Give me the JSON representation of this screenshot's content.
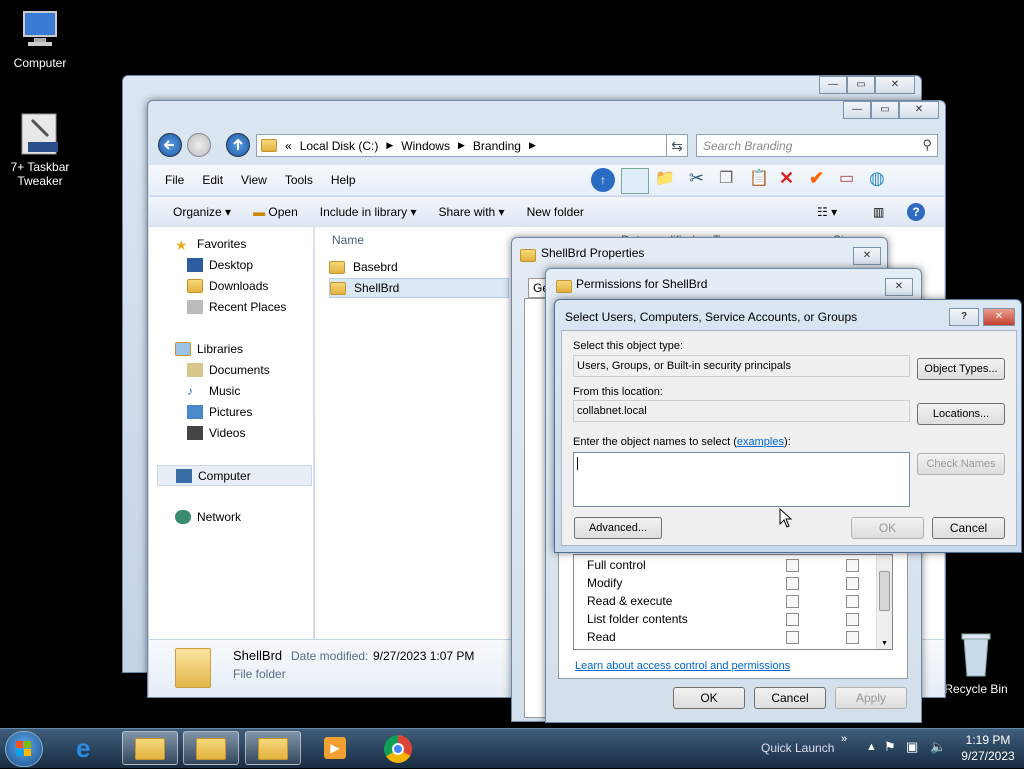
{
  "desktop": {
    "computer_label": "Computer",
    "tweaker_label_1": "7+ Taskbar",
    "tweaker_label_2": "Tweaker",
    "recycle_label": "Recycle Bin"
  },
  "explorer": {
    "address": {
      "part1": "Local Disk (C:)",
      "part2": "Windows",
      "part3": "Branding",
      "prefix": "«"
    },
    "search_placeholder": "Search Branding",
    "menu": [
      "File",
      "Edit",
      "View",
      "Tools",
      "Help"
    ],
    "toolbar": {
      "organize": "Organize",
      "open": "Open",
      "include": "Include in library",
      "share": "Share with",
      "newfolder": "New folder"
    },
    "nav": {
      "favorites": "Favorites",
      "desktop": "Desktop",
      "downloads": "Downloads",
      "recent": "Recent Places",
      "libraries": "Libraries",
      "documents": "Documents",
      "music": "Music",
      "pictures": "Pictures",
      "videos": "Videos",
      "computer": "Computer",
      "network": "Network"
    },
    "columns": {
      "name": "Name",
      "date": "Date modified",
      "type": "Type",
      "size": "Size"
    },
    "files": [
      {
        "name": "Basebrd"
      },
      {
        "name": "ShellBrd"
      }
    ],
    "details": {
      "name": "ShellBrd",
      "date_label": "Date modified:",
      "date": "9/27/2023 1:07 PM",
      "type": "File folder"
    }
  },
  "props": {
    "title": "ShellBrd Properties",
    "tab_partial": "Ge"
  },
  "perms": {
    "title": "Permissions for ShellBrd",
    "rows": [
      "Full control",
      "Modify",
      "Read & execute",
      "List folder contents",
      "Read"
    ],
    "link": "Learn about access control and permissions",
    "ok": "OK",
    "cancel": "Cancel",
    "apply": "Apply"
  },
  "select": {
    "title": "Select Users, Computers, Service Accounts, or Groups",
    "type_label": "Select this object type:",
    "type_value": "Users, Groups, or Built-in security principals",
    "object_types": "Object Types...",
    "loc_label": "From this location:",
    "loc_value": "collabnet.local",
    "locations": "Locations...",
    "enter_label": "Enter the object names to select (",
    "examples": "examples",
    "enter_label_end": "):",
    "check_names": "Check Names",
    "advanced": "Advanced...",
    "ok": "OK",
    "cancel": "Cancel",
    "help": "?"
  },
  "taskbar": {
    "quick_launch": "Quick Launch",
    "time": "1:19 PM",
    "date": "9/27/2023"
  }
}
